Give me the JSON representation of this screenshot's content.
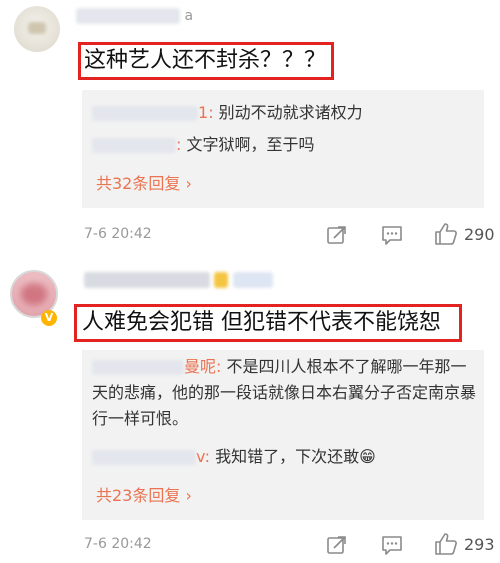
{
  "comments": [
    {
      "text": "这种艺人还不封杀？？？",
      "username_fragment": "a",
      "replies": [
        {
          "user_fragment": "1",
          "text": "别动不动就求诸权力"
        },
        {
          "user_fragment": "",
          "text": "文字狱啊，至于吗"
        }
      ],
      "more_replies": "共32条回复 ›",
      "time": "7-6 20:42",
      "likes": "290"
    },
    {
      "text": "人难免会犯错 但犯错不代表不能饶恕",
      "username_fragment": "",
      "replies": [
        {
          "user_fragment": "曼呢",
          "text": "不是四川人根本不了解哪一年那一天的悲痛，他的那一段话就像日本右翼分子否定南京暴行一样可恨。"
        },
        {
          "user_fragment": "v",
          "text": "我知错了，下次还敢😁"
        }
      ],
      "more_replies": "共23条回复 ›",
      "time": "7-6 20:42",
      "likes": "293"
    }
  ],
  "icons": [
    "share-icon",
    "comment-icon",
    "like-icon",
    "verified-badge-icon"
  ],
  "colors": {
    "highlight_box": "#e3231f",
    "link": "#eb7350",
    "reply_bg": "#f2f2f2"
  }
}
